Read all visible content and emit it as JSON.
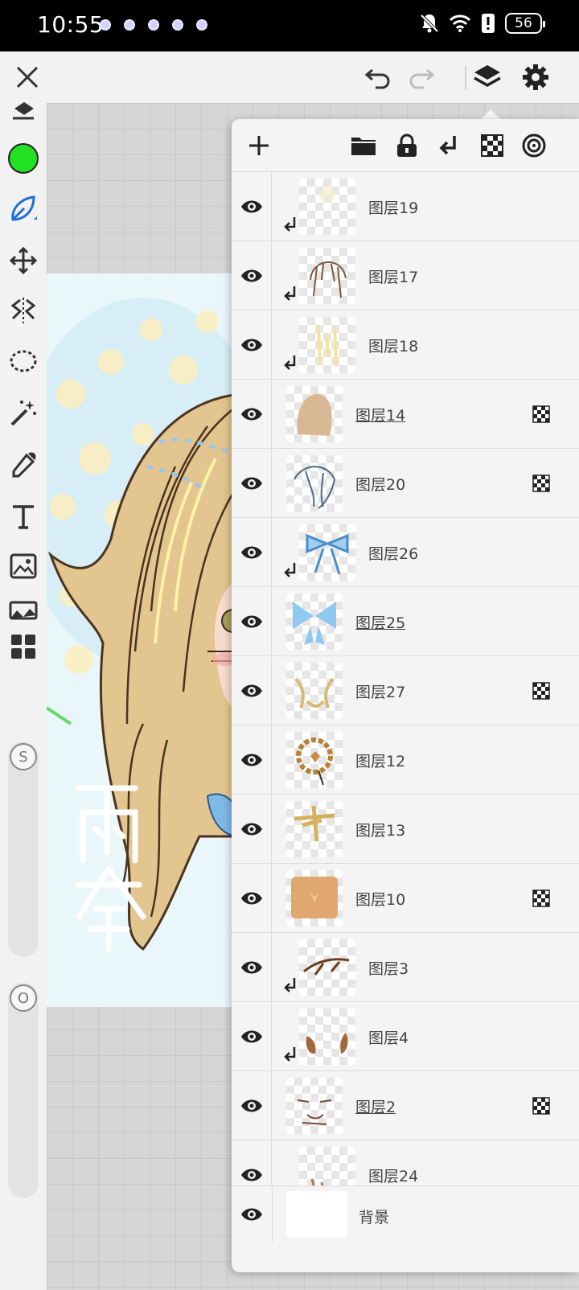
{
  "status_bar": {
    "time": "10:55",
    "battery": "56"
  },
  "tools": {
    "left": [
      "eraser-icon",
      "color-swatch",
      "brush-icon",
      "move-icon",
      "symmetry-icon",
      "lasso-icon",
      "magic-wand-icon",
      "eyedropper-icon",
      "text-icon",
      "image-import-icon",
      "filter-icon",
      "gallery-icon"
    ],
    "current_color": "#22e022",
    "size_slider_label": "S",
    "opacity_slider_label": "O"
  },
  "layers_panel": {
    "layers": [
      {
        "name": "图层19",
        "clipped": true,
        "underlined": false,
        "fx": false
      },
      {
        "name": "图层17",
        "clipped": true,
        "underlined": false,
        "fx": false
      },
      {
        "name": "图层18",
        "clipped": true,
        "underlined": false,
        "fx": false
      },
      {
        "name": "图层14",
        "clipped": false,
        "underlined": true,
        "fx": true
      },
      {
        "name": "图层20",
        "clipped": false,
        "underlined": false,
        "fx": true
      },
      {
        "name": "图层26",
        "clipped": true,
        "underlined": false,
        "fx": false
      },
      {
        "name": "图层25",
        "clipped": false,
        "underlined": true,
        "fx": false
      },
      {
        "name": "图层27",
        "clipped": false,
        "underlined": false,
        "fx": true
      },
      {
        "name": "图层12",
        "clipped": false,
        "underlined": false,
        "fx": false
      },
      {
        "name": "图层13",
        "clipped": false,
        "underlined": false,
        "fx": false
      },
      {
        "name": "图层10",
        "clipped": false,
        "underlined": false,
        "fx": true
      },
      {
        "name": "图层3",
        "clipped": true,
        "underlined": false,
        "fx": false
      },
      {
        "name": "图层4",
        "clipped": true,
        "underlined": false,
        "fx": false
      },
      {
        "name": "图层2",
        "clipped": false,
        "underlined": true,
        "fx": true
      },
      {
        "name": "图层24",
        "clipped": true,
        "underlined": false,
        "fx": false
      }
    ],
    "background_layer": "背景"
  }
}
